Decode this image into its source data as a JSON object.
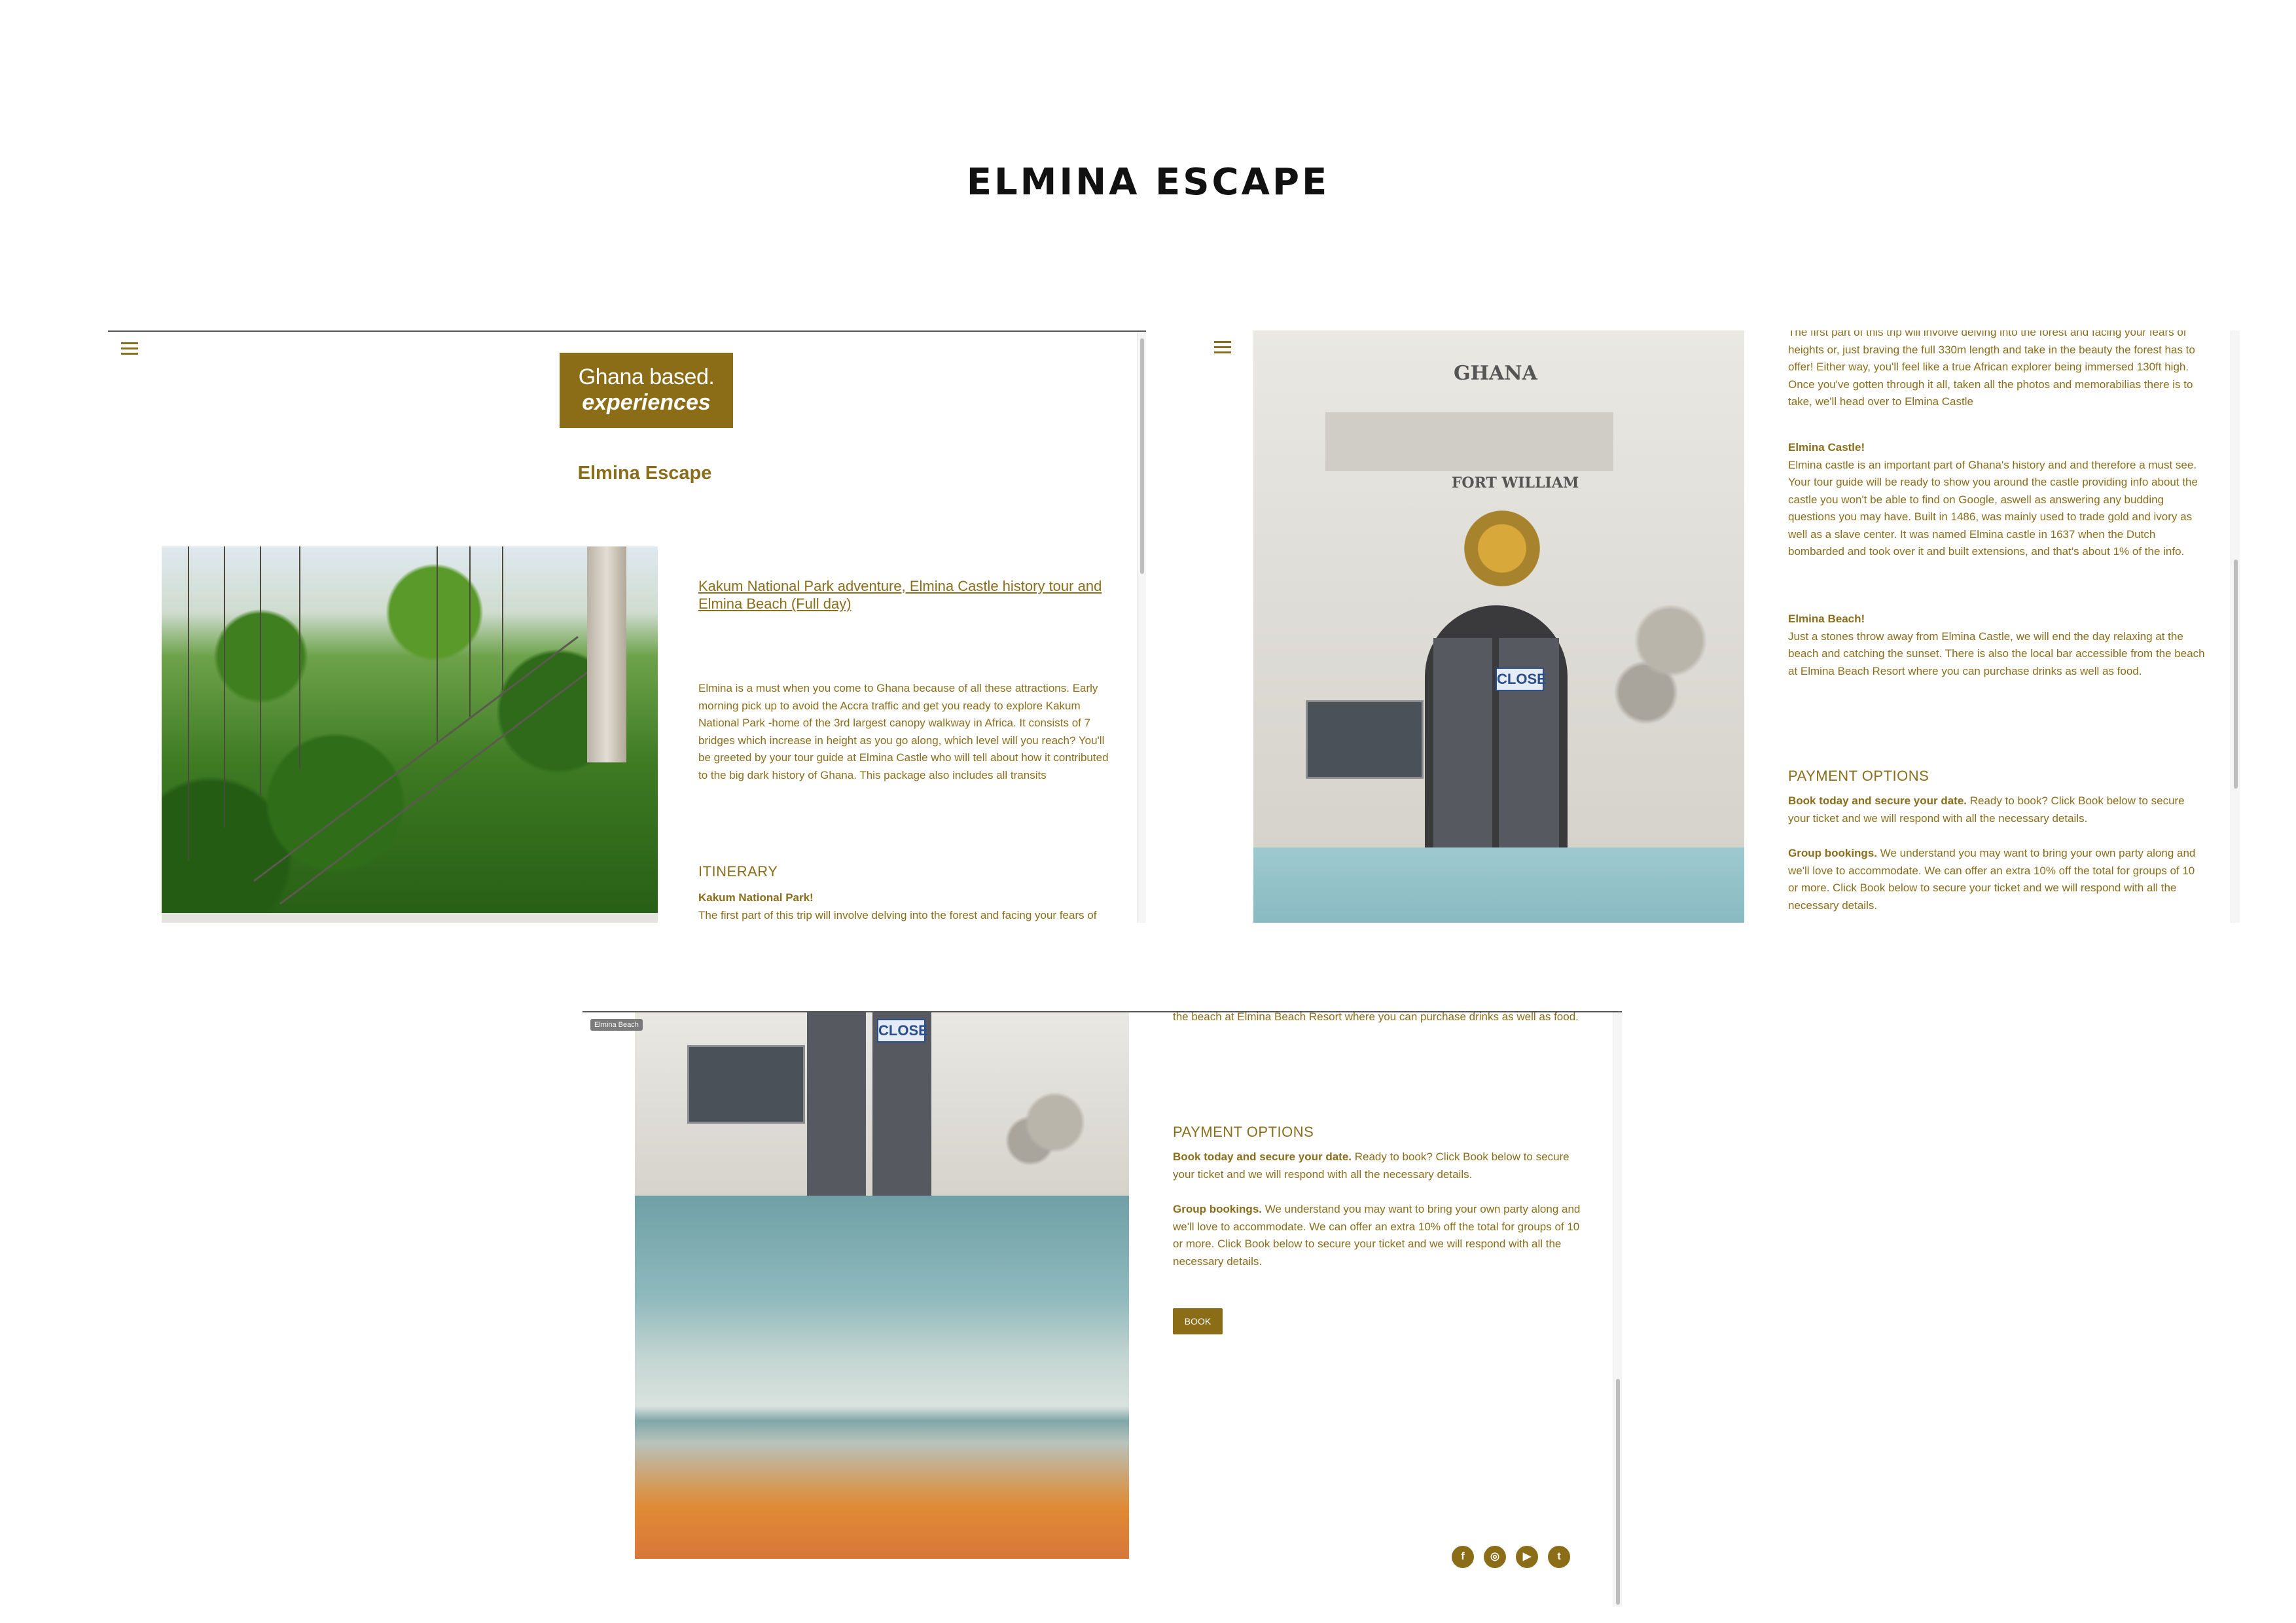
{
  "page": {
    "title": "ELMINA ESCAPE"
  },
  "screen1": {
    "logo": {
      "line1": "Ghana based.",
      "line2": "experiences"
    },
    "package_title": "Elmina Escape",
    "tour_link": "Kakum National Park adventure, Elmina Castle history tour and Elmina Beach (Full day)",
    "intro": "Elmina is a must when you come to Ghana because of all these attractions. Early morning pick up to avoid the Accra traffic and get you ready to explore Kakum National Park -home of the 3rd largest canopy walkway in Africa. It consists of 7 bridges which increase in height as you go along, which level will you reach? You'll be greeted by your tour guide at Elmina Castle who will tell about how it contributed to the big dark history of Ghana. This package also includes all transits",
    "itinerary_heading": "ITINERARY",
    "kakum_heading": "Kakum National Park!",
    "kakum_text": "The first part of this trip will involve delving into the forest and facing your fears of heights or, just braving the full 330m length and take in the beauty the"
  },
  "screen2": {
    "kakum_cont": "The first part of this trip will involve delving into the forest and facing your fears of heights or, just braving the full 330m length and take in the beauty the forest has to offer! Either way, you'll feel like a true African explorer being immersed 130ft high. Once you've gotten through it all, taken all the photos and memorabilias there is to take, we'll head over to Elmina Castle",
    "castle_heading": "Elmina Castle!",
    "castle_text": "Elmina castle is an important part of Ghana's history and and therefore a must see. Your tour guide will be ready to show you around the castle providing info about the castle you won't be able to find on Google, aswell as answering any budding questions you may have. Built in 1486, was mainly used to trade gold and ivory as well as a slave center. It was named Elmina castle in 1637 when the Dutch bombarded and took over it and built extensions, and that's about 1% of the info.",
    "beach_heading": "Elmina Beach!",
    "beach_text": "Just a stones throw away from Elmina Castle, we will end the day relaxing at the beach and catching the sunset. There is also the local bar accessible from the beach at Elmina Beach Resort where you can purchase drinks as well as food.",
    "payment_heading": "PAYMENT OPTIONS",
    "book_today_bold": "Book today and secure your date.",
    "book_today_text": " Ready to book? Click Book below to secure your ticket and we will respond with all the necessary details.",
    "group_bold": "Group bookings.",
    "group_text": " We understand you may want to bring your own party along and we'll love to accommodate. We can offer an extra 10% off the total for groups of 10 or more. Click Book below to secure your ticket and we will respond with all the necessary details.",
    "castle_signs": {
      "ghana": "GHANA",
      "fort": "FORT WILLIAM",
      "close": "CLOSE"
    }
  },
  "screen3": {
    "photo_tag": "Elmina Beach",
    "beach_tail": "the beach at Elmina Beach Resort where you can purchase drinks as well as food.",
    "payment_heading": "PAYMENT OPTIONS",
    "book_today_bold": "Book today and secure your date.",
    "book_today_text": " Ready to book? Click Book below to secure your ticket and we will respond with all the necessary details.",
    "group_bold": "Group bookings.",
    "group_text": " We understand you may want to bring your own party along and we'll love to accommodate. We can offer an extra 10% off the total for groups of 10 or more. Click Book below to secure your ticket and we will respond with all the necessary details.",
    "book_button": "BOOK",
    "close_sign": "CLOSE",
    "social": [
      "f",
      "◎",
      "▶",
      "t"
    ]
  },
  "colors": {
    "brand": "#8b6c17",
    "text": "#8a6e1c"
  }
}
